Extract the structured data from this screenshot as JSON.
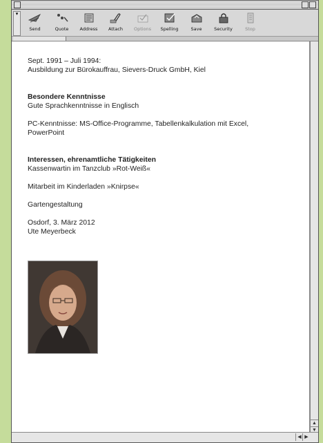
{
  "toolbar": {
    "items": [
      {
        "label": "Send",
        "icon": "send-icon",
        "enabled": true
      },
      {
        "label": "Quote",
        "icon": "quote-icon",
        "enabled": true
      },
      {
        "label": "Address",
        "icon": "address-icon",
        "enabled": true
      },
      {
        "label": "Attach",
        "icon": "attach-icon",
        "enabled": true
      },
      {
        "label": "Options",
        "icon": "options-icon",
        "enabled": false
      },
      {
        "label": "Spelling",
        "icon": "spelling-icon",
        "enabled": true
      },
      {
        "label": "Save",
        "icon": "save-icon",
        "enabled": true
      },
      {
        "label": "Security",
        "icon": "security-icon",
        "enabled": true
      },
      {
        "label": "Stop",
        "icon": "stop-icon",
        "enabled": false
      }
    ]
  },
  "document": {
    "education_dates": "Sept. 1991 – Juli 1994:",
    "education_text": "Ausbildung zur Bürokauffrau, Sievers-Druck GmbH, Kiel",
    "skills_heading": "Besondere Kenntnisse",
    "skills_language": "Gute Sprachkenntnisse in Englisch",
    "skills_pc_line1": "PC-Kenntnisse: MS-Office-Programme, Tabellenkalkulation mit Excel,",
    "skills_pc_line2": "PowerPoint",
    "interests_heading": "Interessen, ehrenamtliche Tätigkeiten",
    "interest_1": "Kassenwartin im Tanzclub »Rot-Weiß«",
    "interest_2": "Mitarbeit im Kinderladen »Knirpse«",
    "interest_3": "Gartengestaltung",
    "place_date": "Osdorf, 3. März 2012",
    "signature_name": "Ute Meyerbeck"
  },
  "colors": {
    "background": "#c5dc9b",
    "window": "#dcdcdc",
    "page": "#ffffff"
  }
}
